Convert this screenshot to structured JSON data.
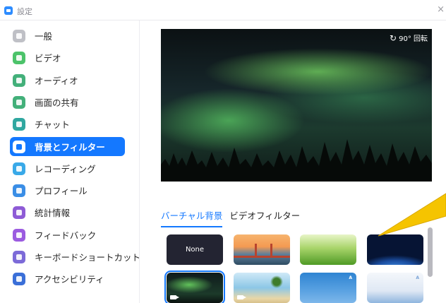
{
  "window": {
    "title": "設定",
    "close_glyph": "×"
  },
  "sidebar": {
    "items": [
      {
        "label": "一般",
        "icon": "gear-icon",
        "color": "#bfc0c6",
        "active": false
      },
      {
        "label": "ビデオ",
        "icon": "video-icon",
        "color": "#4cc36a",
        "active": false
      },
      {
        "label": "オーディオ",
        "icon": "headphone-icon",
        "color": "#43b07a",
        "active": false
      },
      {
        "label": "画面の共有",
        "icon": "screen-share-icon",
        "color": "#43b07a",
        "active": false
      },
      {
        "label": "チャット",
        "icon": "chat-icon",
        "color": "#2fa7a0",
        "active": false
      },
      {
        "label": "背景とフィルター",
        "icon": "background-icon",
        "color": "#1478ff",
        "active": true
      },
      {
        "label": "レコーディング",
        "icon": "record-icon",
        "color": "#39a9e8",
        "active": false
      },
      {
        "label": "プロフィール",
        "icon": "profile-icon",
        "color": "#3a8ee6",
        "active": false
      },
      {
        "label": "統計情報",
        "icon": "stats-icon",
        "color": "#8e5bd6",
        "active": false
      },
      {
        "label": "フィードバック",
        "icon": "feedback-icon",
        "color": "#9b5be0",
        "active": false
      },
      {
        "label": "キーボードショートカット",
        "icon": "keyboard-icon",
        "color": "#7c6ad8",
        "active": false
      },
      {
        "label": "アクセシビリティ",
        "icon": "accessibility-icon",
        "color": "#3a6fd8",
        "active": false
      }
    ]
  },
  "preview": {
    "rotate_label": "90° 回転",
    "rotate_glyph": "↻"
  },
  "tabs": [
    {
      "label": "バーチャル背景",
      "active": true
    },
    {
      "label": "ビデオフィルター",
      "active": false
    }
  ],
  "backgrounds": {
    "none_label": "None",
    "items": [
      {
        "name": "none",
        "selected": false
      },
      {
        "name": "golden-gate-bridge",
        "selected": false
      },
      {
        "name": "grass",
        "selected": false
      },
      {
        "name": "earth-from-space",
        "selected": false
      },
      {
        "name": "aurora",
        "selected": true
      },
      {
        "name": "beach",
        "selected": false
      },
      {
        "name": "blue-sky",
        "selected": false
      },
      {
        "name": "light-sky",
        "selected": false
      }
    ]
  },
  "colors": {
    "accent": "#1478ff",
    "callout": "#f5c400"
  }
}
